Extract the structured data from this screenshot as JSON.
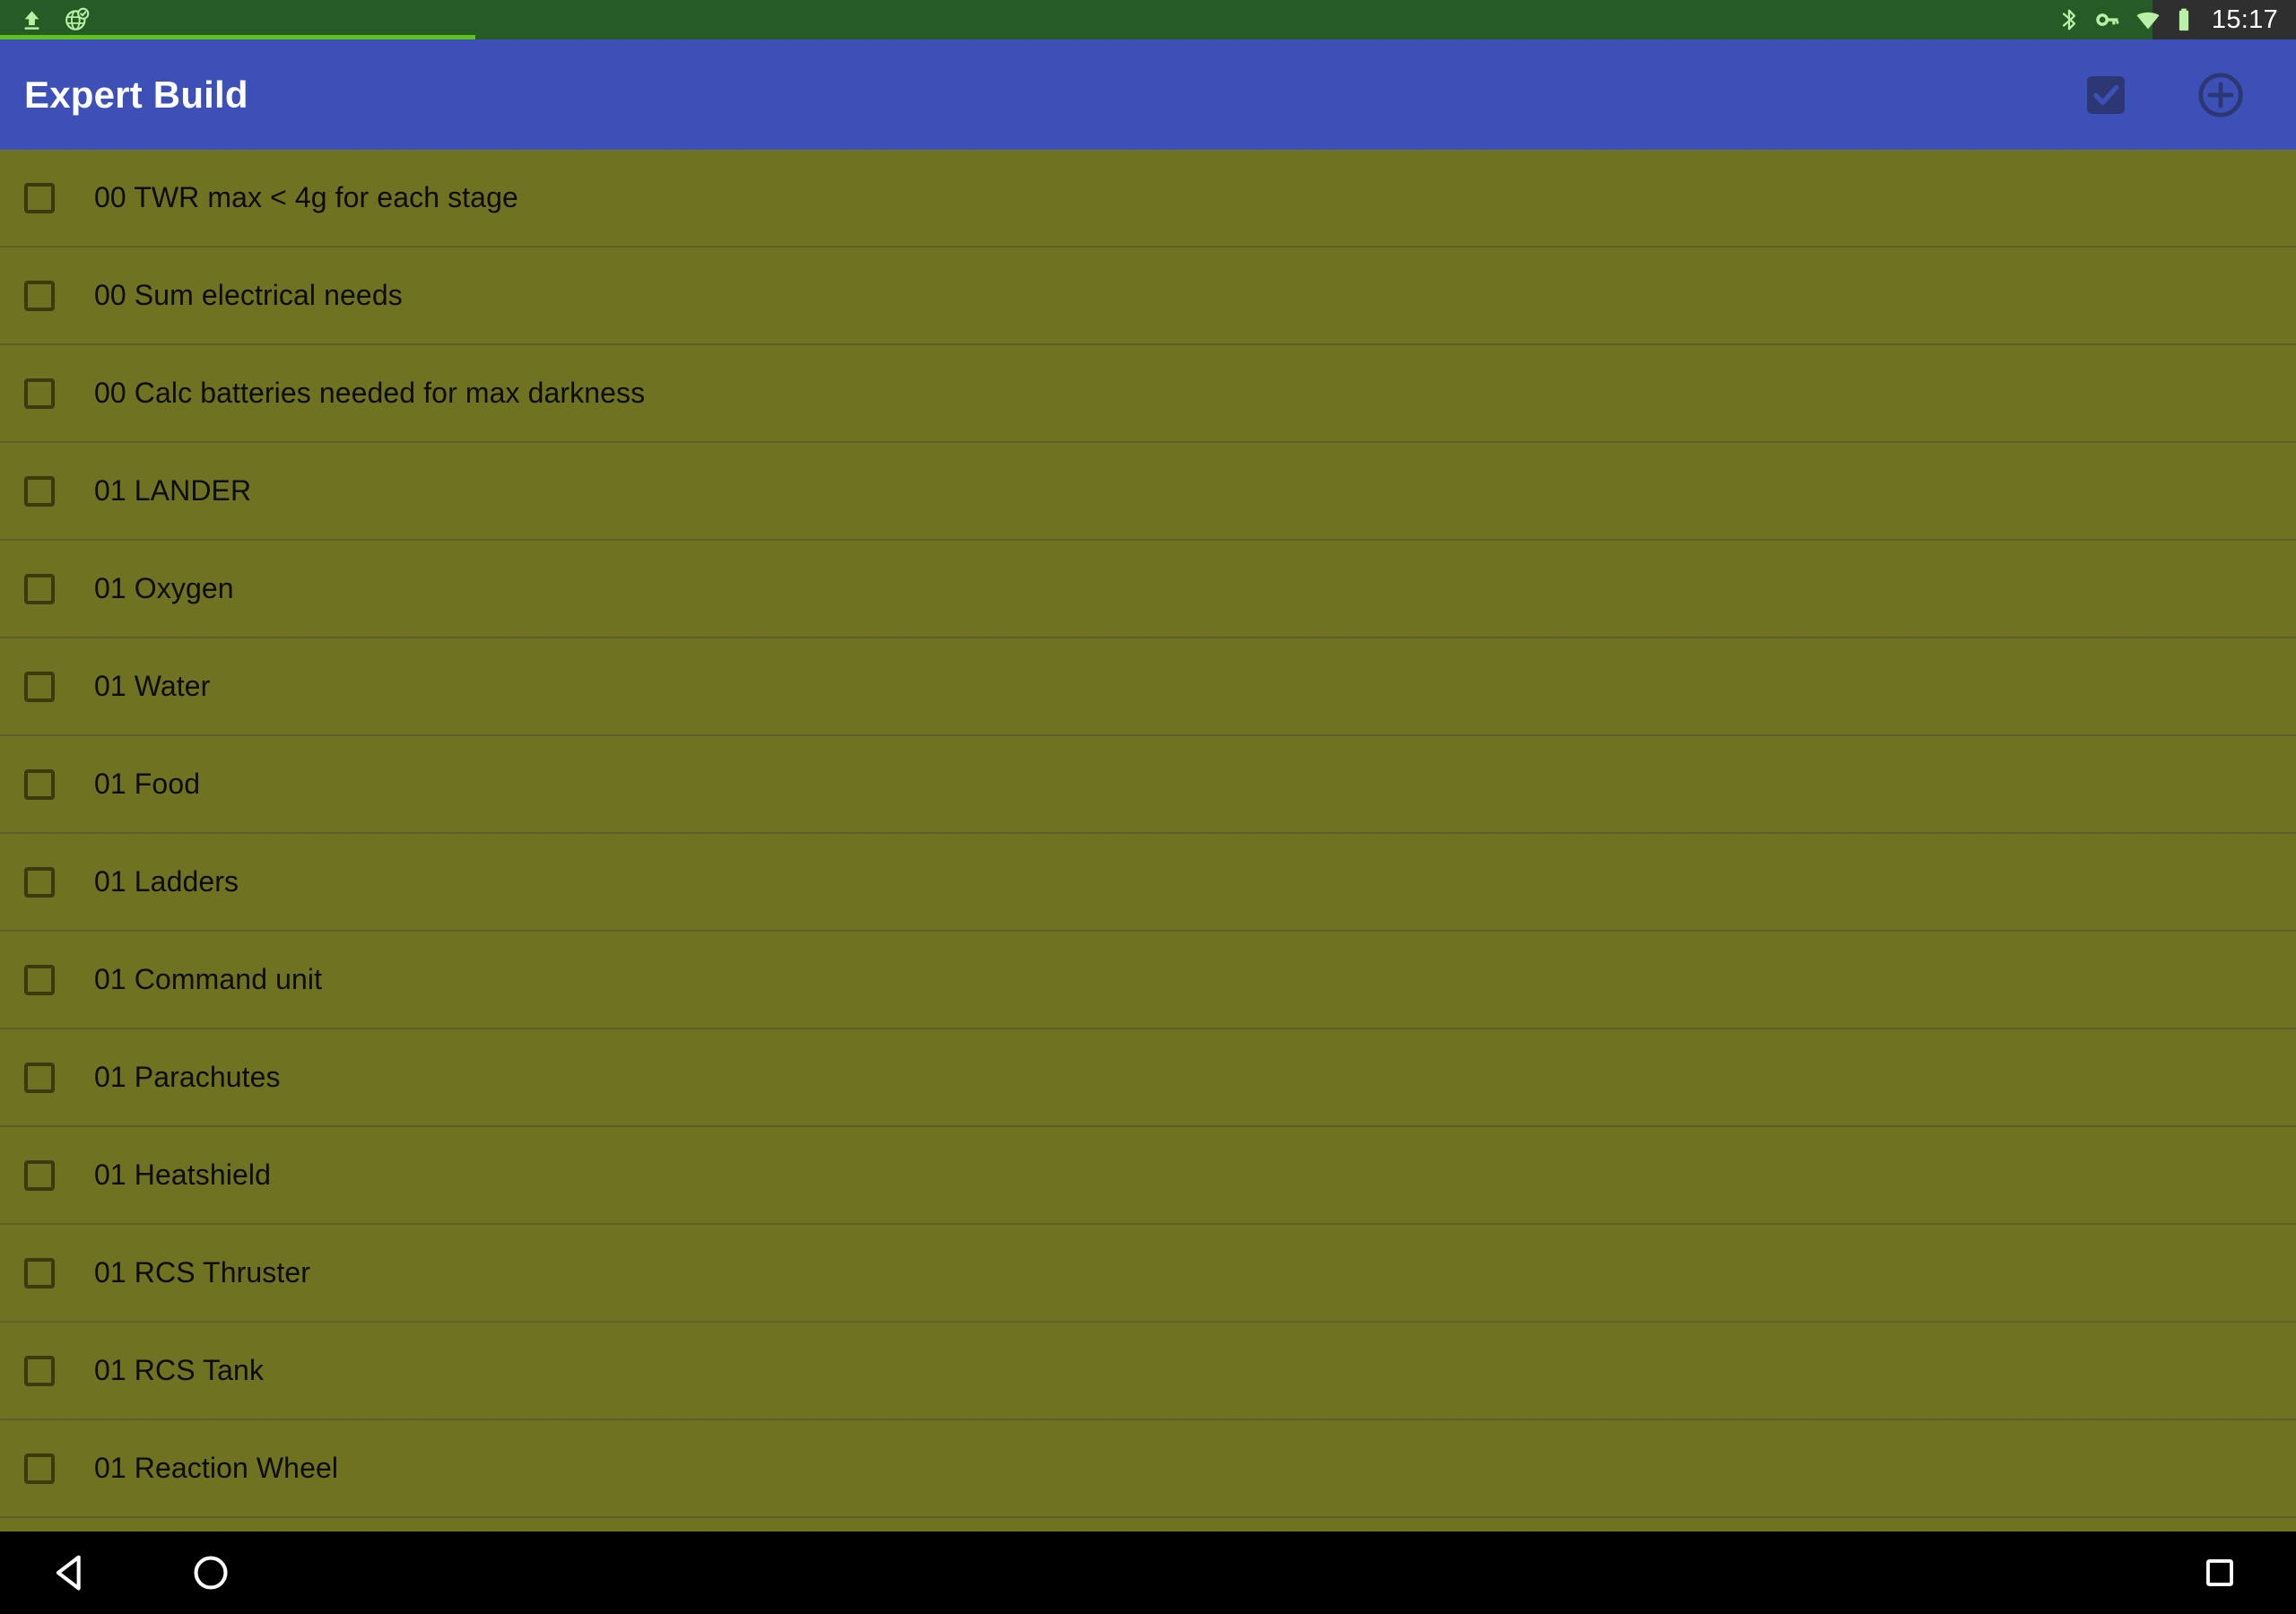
{
  "status_bar": {
    "left_icons": [
      {
        "name": "upload-icon",
        "label": "upload"
      },
      {
        "name": "globe-check-icon",
        "label": "browser-sync"
      }
    ],
    "right_icons": [
      {
        "name": "bluetooth-icon",
        "label": "bluetooth"
      },
      {
        "name": "vpn-key-icon",
        "label": "vpn"
      },
      {
        "name": "wifi-icon",
        "label": "wifi"
      },
      {
        "name": "battery-icon",
        "label": "battery"
      }
    ],
    "clock": "15:17",
    "colors": {
      "background": "#255b25",
      "icon": "#b9f0a5",
      "progress": "#5ec21c",
      "clock_text": "#ffffff"
    }
  },
  "app_bar": {
    "title": "Expert Build",
    "actions": [
      {
        "name": "select-all-checkbox-button",
        "icon": "checkbox-checked-icon",
        "label": "Select all"
      },
      {
        "name": "add-item-button",
        "icon": "plus-circle-icon",
        "label": "Add"
      }
    ],
    "colors": {
      "background": "#3c50b8",
      "title_text": "#ffffff",
      "icon": "#2c3773"
    }
  },
  "list": {
    "colors": {
      "background": "#6f7220",
      "divider": "#5d5f2b",
      "text": "#0d0d08",
      "checkbox_border": "#3e3a10"
    },
    "items": [
      {
        "label": "00 TWR max < 4g for each stage",
        "checked": false
      },
      {
        "label": "00 Sum electrical needs",
        "checked": false
      },
      {
        "label": "00 Calc batteries needed for max darkness",
        "checked": false
      },
      {
        "label": "01 LANDER",
        "checked": false
      },
      {
        "label": "01 Oxygen",
        "checked": false
      },
      {
        "label": "01 Water",
        "checked": false
      },
      {
        "label": "01 Food",
        "checked": false
      },
      {
        "label": "01 Ladders",
        "checked": false
      },
      {
        "label": "01 Command unit",
        "checked": false
      },
      {
        "label": "01 Parachutes",
        "checked": false
      },
      {
        "label": "01 Heatshield",
        "checked": false
      },
      {
        "label": "01 RCS Thruster",
        "checked": false
      },
      {
        "label": "01 RCS Tank",
        "checked": false
      },
      {
        "label": "01 Reaction Wheel",
        "checked": false
      }
    ]
  },
  "nav_bar": {
    "buttons": [
      {
        "name": "nav-back-button",
        "icon": "back-triangle-icon",
        "label": "Back"
      },
      {
        "name": "nav-home-button",
        "icon": "home-circle-icon",
        "label": "Home"
      },
      {
        "name": "nav-recents-button",
        "icon": "recents-square-icon",
        "label": "Recents"
      }
    ],
    "colors": {
      "background": "#000000",
      "icon": "#ffffff"
    }
  }
}
